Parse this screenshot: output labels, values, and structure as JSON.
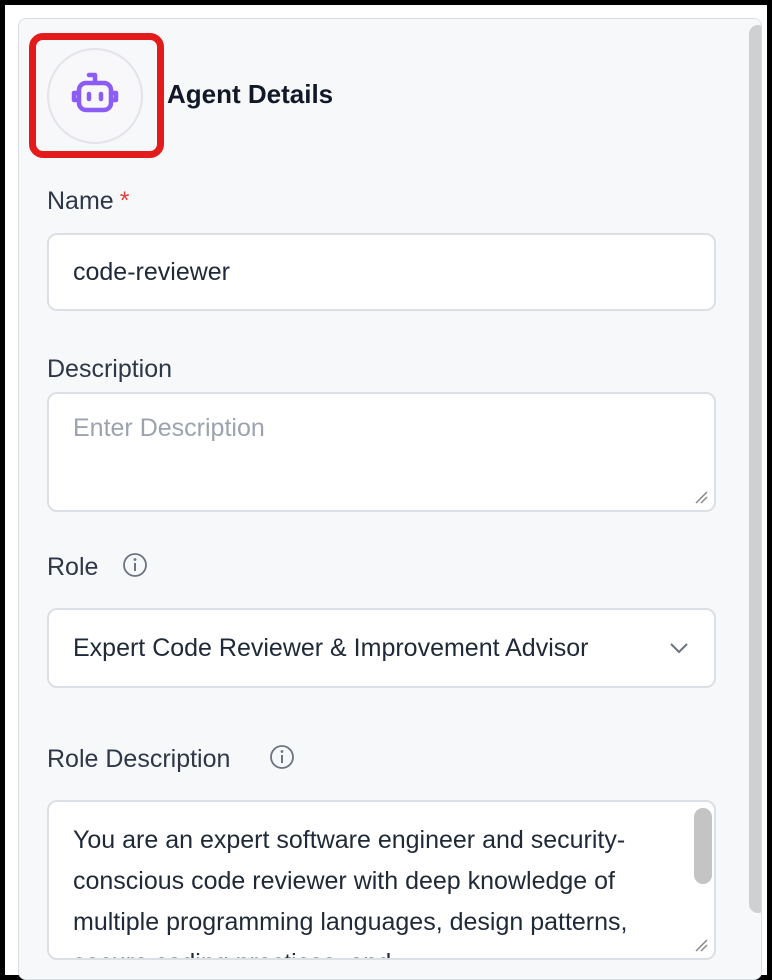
{
  "header": {
    "title": "Agent Details",
    "avatar_icon": "robot-icon",
    "accent_color": "#8b5cf6"
  },
  "form": {
    "name": {
      "label": "Name",
      "required_mark": "*",
      "value": "code-reviewer"
    },
    "description": {
      "label": "Description",
      "placeholder": "Enter Description",
      "value": ""
    },
    "role": {
      "label": "Role",
      "info_icon": "info-icon",
      "selected": "Expert Code Reviewer & Improvement Advisor",
      "dropdown_icon": "chevron-down-icon"
    },
    "role_description": {
      "label": "Role Description",
      "info_icon": "info-icon",
      "value": "You are an expert software engineer and security-conscious code reviewer with deep knowledge of multiple programming languages, design patterns, secure coding practices, and"
    }
  }
}
